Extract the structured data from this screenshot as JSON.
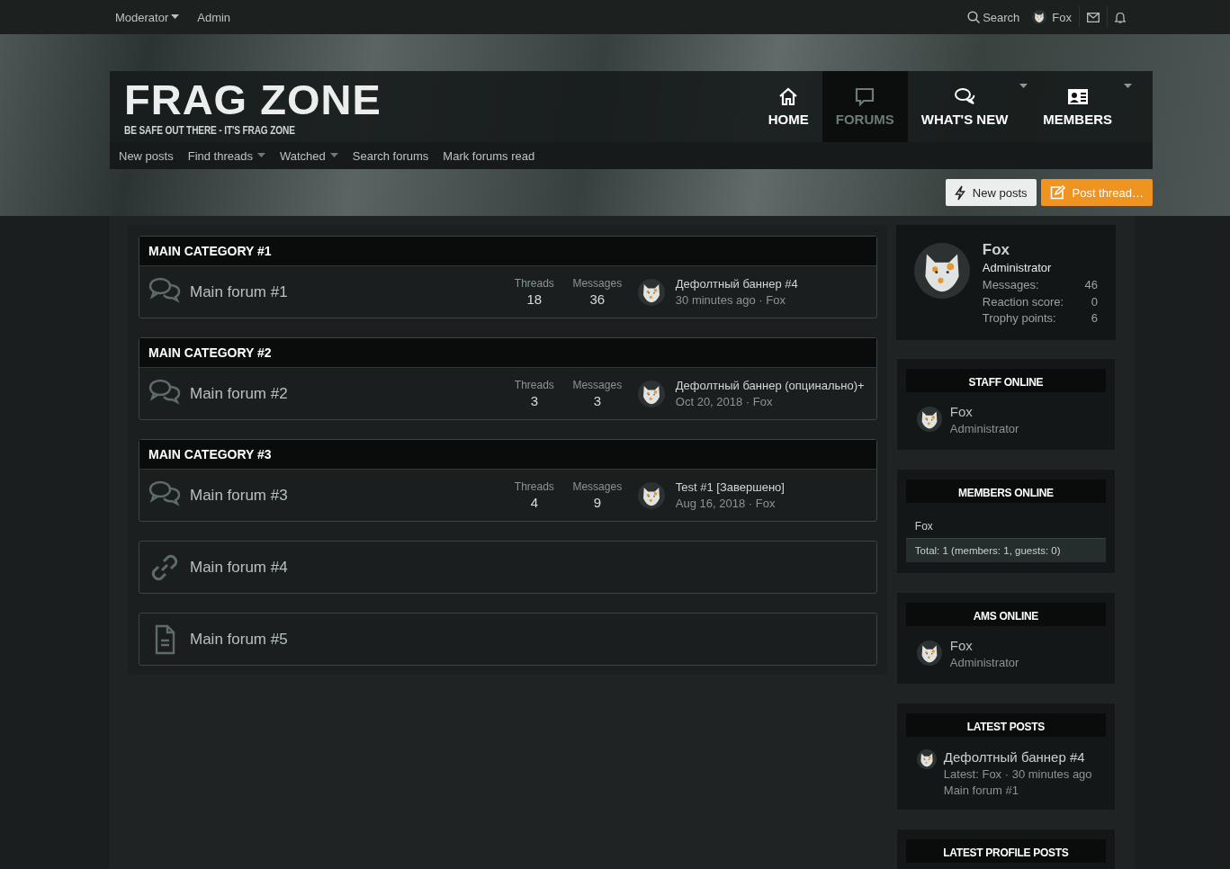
{
  "top_bar": {
    "links": [
      {
        "label": "Moderator",
        "dropdown": true
      },
      {
        "label": "Admin",
        "dropdown": false
      }
    ],
    "search": "Search",
    "user": "Fox"
  },
  "logo": {
    "title": "FRAG ZONE",
    "tagline": "BE SAFE OUT THERE - IT'S FRAG ZONE"
  },
  "nav_tabs": [
    {
      "label": "HOME",
      "kind": "home",
      "selected": false,
      "dropdown": false
    },
    {
      "label": "FORUMS",
      "kind": "forums",
      "selected": true,
      "dropdown": false
    },
    {
      "label": "WHAT'S NEW",
      "kind": "news",
      "selected": false,
      "dropdown": true
    },
    {
      "label": "MEMBERS",
      "kind": "members",
      "selected": false,
      "dropdown": true
    }
  ],
  "sub_nav": [
    {
      "label": "New posts",
      "dropdown": false
    },
    {
      "label": "Find threads",
      "dropdown": true
    },
    {
      "label": "Watched",
      "dropdown": true
    },
    {
      "label": "Search forums",
      "dropdown": false
    },
    {
      "label": "Mark forums read",
      "dropdown": false
    }
  ],
  "actions": [
    {
      "label": "New posts",
      "kind": "secondary"
    },
    {
      "label": "Post thread…",
      "kind": "primary"
    }
  ],
  "categories": [
    {
      "title": "MAIN CATEGORY #1",
      "forums": [
        {
          "name": "Main forum #1",
          "threads_label": "Threads",
          "threads": "18",
          "messages_label": "Messages",
          "messages": "36",
          "last_post": {
            "title": "Дефолтный баннер #4",
            "meta": "30 minutes ago · Fox"
          }
        }
      ]
    },
    {
      "title": "MAIN CATEGORY #2",
      "forums": [
        {
          "name": "Main forum #2",
          "threads_label": "Threads",
          "threads": "3",
          "messages_label": "Messages",
          "messages": "3",
          "last_post": {
            "title": "Дефолтный баннер (опцинально)+",
            "meta": "Oct 20, 2018 · Fox"
          }
        }
      ]
    },
    {
      "title": "MAIN CATEGORY #3",
      "forums": [
        {
          "name": "Main forum #3",
          "threads_label": "Threads",
          "threads": "4",
          "messages_label": "Messages",
          "messages": "9",
          "last_post": {
            "title": "Test #1 [Завершено]",
            "meta": "Aug 16, 2018 · Fox"
          }
        }
      ]
    }
  ],
  "standalone_forums": [
    {
      "name": "Main forum #4",
      "kind": "link"
    },
    {
      "name": "Main forum #5",
      "kind": "page"
    }
  ],
  "profile": {
    "name": "Fox",
    "role": "Administrator",
    "stats": [
      {
        "label": "Messages:",
        "value": "46"
      },
      {
        "label": "Reaction score:",
        "value": "0"
      },
      {
        "label": "Trophy points:",
        "value": "6"
      }
    ]
  },
  "widgets": [
    {
      "kind": "members",
      "title": "STAFF ONLINE",
      "members": [
        {
          "name": "Fox",
          "role": "Administrator"
        }
      ]
    },
    {
      "kind": "names",
      "title": "MEMBERS ONLINE",
      "names": "Fox",
      "footer": "Total: 1 (members: 1, guests: 0)"
    },
    {
      "kind": "members",
      "title": "AMS ONLINE",
      "members": [
        {
          "name": "Fox",
          "role": "Administrator"
        }
      ]
    },
    {
      "kind": "posts",
      "title": "LATEST POSTS",
      "posts": [
        {
          "title": "Дефолтный баннер #4",
          "meta": "Latest: Fox · 30 minutes ago",
          "forum": "Main forum #1"
        }
      ]
    },
    {
      "kind": "empty",
      "title": "LATEST PROFILE POSTS"
    }
  ]
}
